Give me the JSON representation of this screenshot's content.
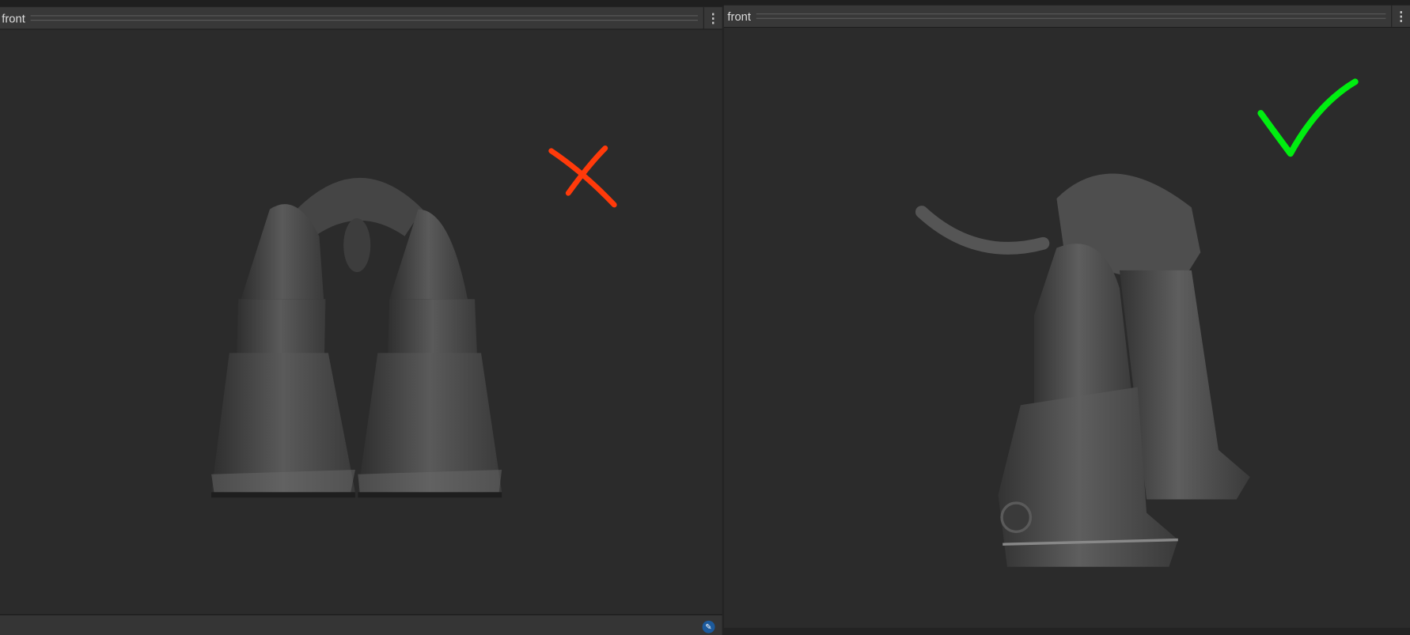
{
  "left_panel": {
    "title": "front",
    "menu_icon": "kebab-menu-icon",
    "mark": "cross",
    "mark_color": "#ff3a0a"
  },
  "right_panel": {
    "title": "front",
    "menu_icon": "kebab-menu-icon",
    "mark": "check",
    "mark_color": "#00ee10"
  },
  "footer": {
    "icon": "tag-icon"
  }
}
